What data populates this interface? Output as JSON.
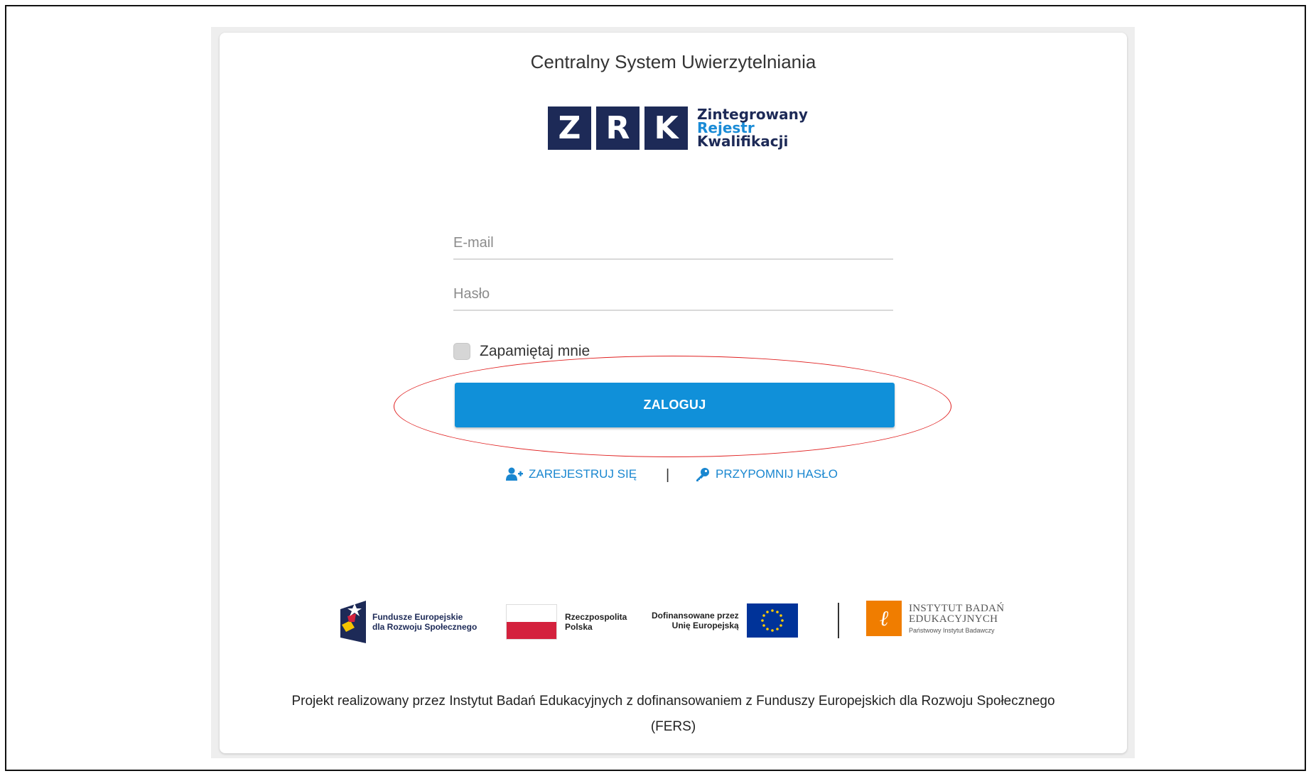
{
  "header": {
    "title": "Centralny System Uwierzytelniania"
  },
  "logo": {
    "letters": [
      "Z",
      "R",
      "K"
    ],
    "line1": "Zintegrowany",
    "line2": "Rejestr",
    "line3": "Kwalifikacji",
    "colors": {
      "dark": "#1d2a57",
      "accent": "#1a8bd6"
    }
  },
  "form": {
    "email_placeholder": "E-mail",
    "password_placeholder": "Hasło",
    "remember_label": "Zapamiętaj mnie",
    "login_label": "ZALOGUJ"
  },
  "links": {
    "register_label": "ZAREJESTRUJ SIĘ",
    "register_icon": "user-plus-icon",
    "separator": "|",
    "remind_label": "PRZYPOMNIJ HASŁO",
    "remind_icon": "key-icon"
  },
  "sponsors": {
    "fe_line1": "Fundusze Europejskie",
    "fe_line2": "dla Rozwoju Społecznego",
    "pl_line1": "Rzeczpospolita",
    "pl_line2": "Polska",
    "eu_line1": "Dofinansowane przez",
    "eu_line2": "Unię Europejską",
    "ibe_line1": "INSTYTUT BADAŃ",
    "ibe_line2": "EDUKACYJNYCH",
    "ibe_line3": "Państwowy Instytut Badawczy"
  },
  "footer": {
    "text": "Projekt realizowany przez Instytut Badań Edukacyjnych z dofinansowaniem z Funduszy Europejskich dla Rozwoju Społecznego (FERS)"
  },
  "colors": {
    "button": "#1090d9",
    "link": "#1a87d0",
    "annotation": "#e02020"
  }
}
